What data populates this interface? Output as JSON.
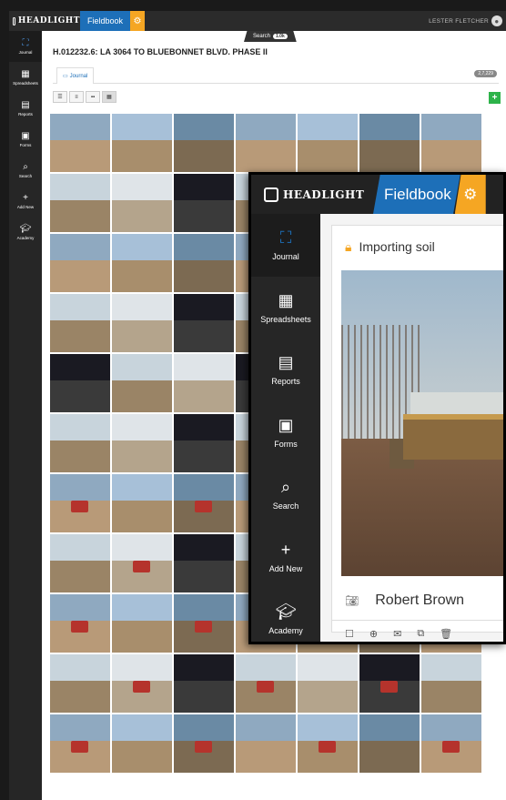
{
  "topbar": {
    "logo": "HEADLIGHT",
    "product": "Fieldbook",
    "user": "LESTER FLETCHER"
  },
  "sidebar": {
    "items": [
      {
        "label": "Journal",
        "icon": "binoculars-icon"
      },
      {
        "label": "Spreadsheets",
        "icon": "table-icon"
      },
      {
        "label": "Reports",
        "icon": "report-icon"
      },
      {
        "label": "Forms",
        "icon": "forms-icon"
      },
      {
        "label": "Search",
        "icon": "search-icon"
      },
      {
        "label": "Add New",
        "icon": "plus-icon"
      },
      {
        "label": "Academy",
        "icon": "graduation-cap-icon"
      }
    ]
  },
  "search_tab": {
    "label": "Search",
    "count": "1.0k"
  },
  "page": {
    "title": "H.012232.6: LA 3064 TO BLUEBONNET BLVD. PHASE II",
    "tab_label": "Journal",
    "entries_badge": "2,7,229"
  },
  "popup": {
    "logo": "HEADLIGHT",
    "product": "Fieldbook",
    "card_title": "Importing soil",
    "photographer": "Robert Brown",
    "sidebar": [
      "Journal",
      "Spreadsheets",
      "Reports",
      "Forms",
      "Search",
      "Add New",
      "Academy"
    ]
  },
  "colors": {
    "brand_blue": "#1d6fb8",
    "brand_orange": "#f5a623",
    "sidebar_dark": "#262626",
    "add_green": "#2db34a"
  }
}
